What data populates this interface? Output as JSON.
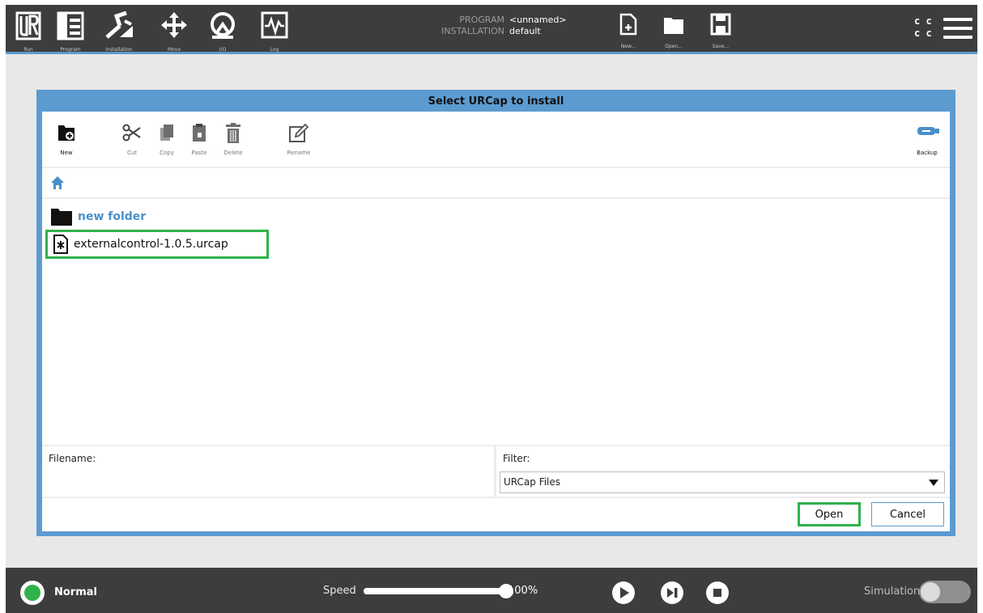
{
  "header": {
    "nav": [
      {
        "label": "Run",
        "icon": "ur-logo-icon"
      },
      {
        "label": "Program",
        "icon": "program-icon"
      },
      {
        "label": "Installation",
        "icon": "installation-icon"
      },
      {
        "label": "Move",
        "icon": "move-icon"
      },
      {
        "label": "I/O",
        "icon": "io-icon"
      },
      {
        "label": "Log",
        "icon": "log-icon"
      }
    ],
    "program_key": "PROGRAM",
    "program_value": "<unnamed>",
    "installation_key": "INSTALLATION",
    "installation_value": "default",
    "file_actions": [
      {
        "label": "New...",
        "icon": "new-file-icon"
      },
      {
        "label": "Open...",
        "icon": "open-folder-icon"
      },
      {
        "label": "Save...",
        "icon": "save-icon"
      }
    ],
    "cc_top": "c c",
    "cc_bottom": "c c",
    "menu_icon": "hamburger-menu-icon"
  },
  "dialog": {
    "title": "Select URCap to install",
    "toolbar": [
      {
        "label": "New",
        "icon": "new-folder-icon"
      },
      {
        "label": "Cut",
        "icon": "scissors-icon"
      },
      {
        "label": "Copy",
        "icon": "copy-icon"
      },
      {
        "label": "Paste",
        "icon": "paste-icon"
      },
      {
        "label": "Delete",
        "icon": "trash-icon"
      },
      {
        "label": "Rename",
        "icon": "rename-icon"
      }
    ],
    "backup_label": "Backup",
    "path_icon": "home-icon",
    "files": [
      {
        "name": "new folder",
        "type": "folder"
      },
      {
        "name": "externalcontrol-1.0.5.urcap",
        "type": "urcap",
        "highlighted": true
      }
    ],
    "filename_label": "Filename:",
    "filename_value": "",
    "filter_label": "Filter:",
    "filter_selected": "URCap Files",
    "open_label": "Open",
    "cancel_label": "Cancel",
    "highlight_color": "#2fb24c",
    "accent_color": "#5c9bd0"
  },
  "footer": {
    "status": "Normal",
    "status_color": "#2fb24c",
    "speed_label": "Speed",
    "speed_value": "100%",
    "speed_fraction": 1.0,
    "controls": [
      "play-icon",
      "step-icon",
      "stop-icon"
    ],
    "simulation_label": "Simulation",
    "simulation_on": false
  }
}
